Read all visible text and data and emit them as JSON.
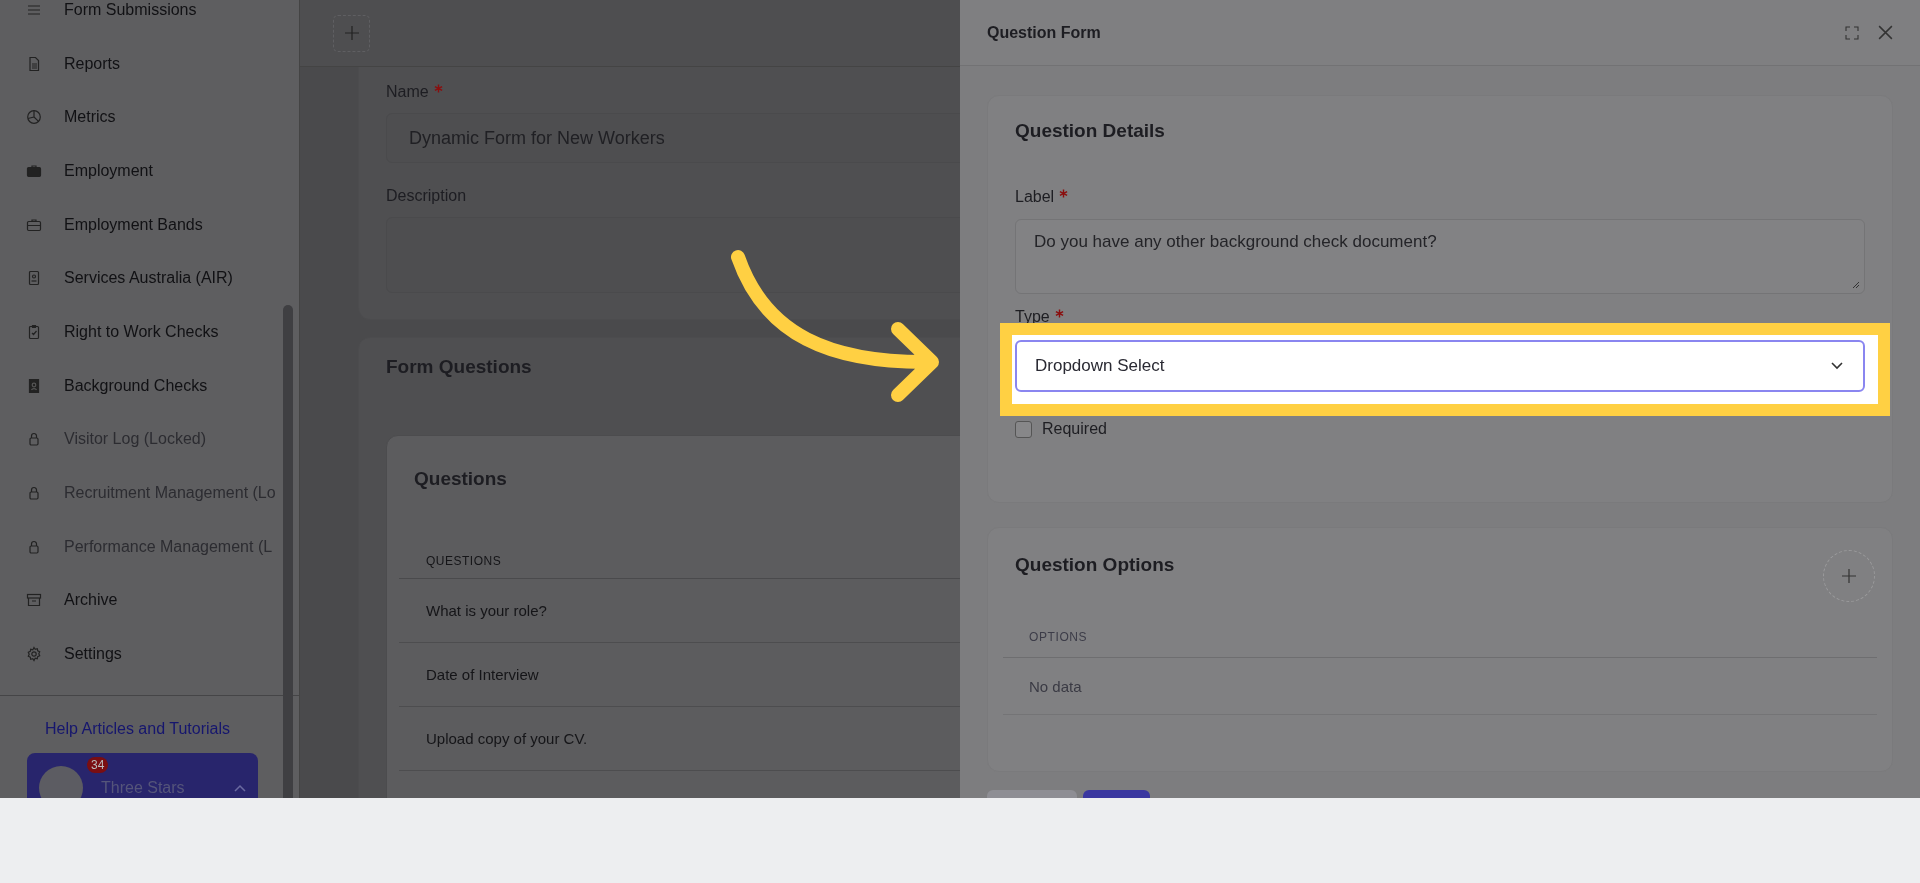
{
  "sidebar": {
    "items": [
      {
        "label": "Form Submissions",
        "locked": false
      },
      {
        "label": "Reports",
        "locked": false
      },
      {
        "label": "Metrics",
        "locked": false
      },
      {
        "label": "Employment",
        "locked": false
      },
      {
        "label": "Employment Bands",
        "locked": false
      },
      {
        "label": "Services Australia (AIR)",
        "locked": false
      },
      {
        "label": "Right to Work Checks",
        "locked": false
      },
      {
        "label": "Background Checks",
        "locked": false
      },
      {
        "label": "Visitor Log (Locked)",
        "locked": true
      },
      {
        "label": "Recruitment Management (Lo",
        "locked": true
      },
      {
        "label": "Performance Management (L",
        "locked": true
      },
      {
        "label": "Archive",
        "locked": false
      },
      {
        "label": "Settings",
        "locked": false
      }
    ],
    "help_link": "Help Articles and Tutorials",
    "organization": {
      "name": "Three Stars",
      "badge": "34"
    }
  },
  "form": {
    "name_label": "Name",
    "name_required": true,
    "name_value": "Dynamic Form for New Workers",
    "description_label": "Description"
  },
  "form_questions": {
    "title": "Form Questions",
    "questions_title": "Questions",
    "column": "QUESTIONS",
    "rows": [
      "What is your role?",
      "Date of Interview",
      "Upload copy of your CV."
    ]
  },
  "question_form": {
    "title": "Question Form",
    "details_title": "Question Details",
    "label_label": "Label",
    "label_required": true,
    "label_value": "Do you have any other background check document?",
    "type_label": "Type",
    "type_required": true,
    "type_value": "Dropdown Select",
    "required_label": "Required",
    "required_checked": false,
    "options_title": "Question Options",
    "options_column": "OPTIONS",
    "empty_text": "No data"
  }
}
